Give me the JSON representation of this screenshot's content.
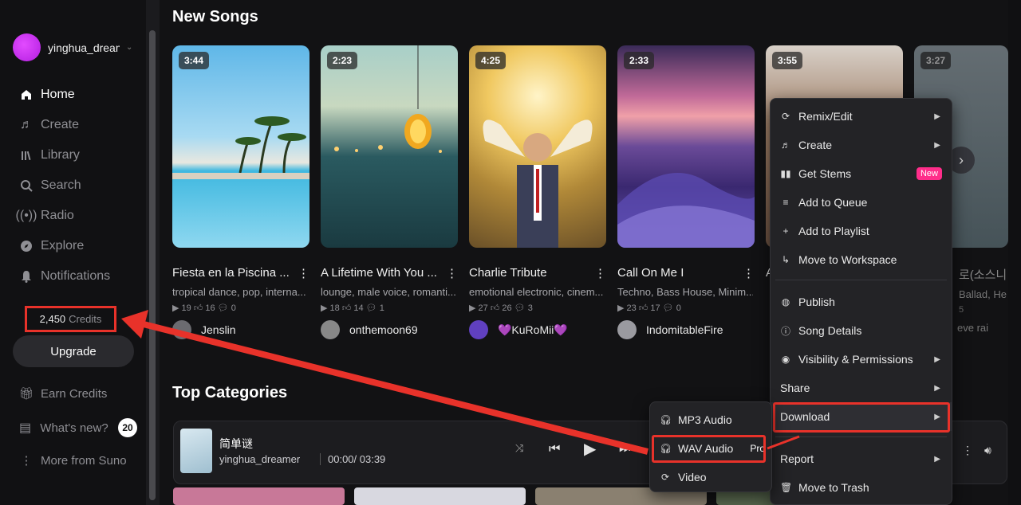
{
  "sidebar": {
    "username": "yinghua_dreamer",
    "nav": [
      {
        "label": "Home",
        "icon": "home-icon"
      },
      {
        "label": "Create",
        "icon": "music-note-icon"
      },
      {
        "label": "Library",
        "icon": "library-icon"
      },
      {
        "label": "Search",
        "icon": "search-icon"
      },
      {
        "label": "Radio",
        "icon": "radio-icon"
      },
      {
        "label": "Explore",
        "icon": "compass-icon"
      },
      {
        "label": "Notifications",
        "icon": "bell-icon"
      }
    ],
    "credits_value": "2,450",
    "credits_label": "Credits",
    "upgrade_label": "Upgrade",
    "earn_credits": "Earn Credits",
    "whats_new": "What's new?",
    "whats_new_count": "20",
    "more_from": "More from Suno"
  },
  "main": {
    "new_songs_title": "New Songs",
    "top_categories_title": "Top Categories",
    "songs": [
      {
        "duration": "3:44",
        "title": "Fiesta en la Piscina ...",
        "genre": "tropical dance, pop, interna...",
        "plays": "19",
        "likes": "16",
        "comments": "0",
        "author": "Jenslin"
      },
      {
        "duration": "2:23",
        "title": "A Lifetime With You ...",
        "genre": "lounge, male voice, romanti...",
        "plays": "18",
        "likes": "14",
        "comments": "1",
        "author": "onthemoon69"
      },
      {
        "duration": "4:25",
        "title": "Charlie Tribute",
        "genre": "emotional electronic, cinem...",
        "plays": "27",
        "likes": "26",
        "comments": "3",
        "author": "💜KuRoMii💜"
      },
      {
        "duration": "2:33",
        "title": "Call On Me I",
        "genre": "Techno, Bass House, Minim...",
        "plays": "23",
        "likes": "17",
        "comments": "0",
        "author": "IndomitableFire"
      },
      {
        "duration": "3:55",
        "title": "A",
        "genre": "",
        "plays": "",
        "likes": "",
        "comments": "",
        "author": ""
      },
      {
        "duration": "3:27",
        "title": "로(소스니",
        "genre": "Ballad, He",
        "plays": "5",
        "likes": "",
        "comments": "",
        "author": "eve rai"
      }
    ]
  },
  "player": {
    "title": "简单谜",
    "user": "yinghua_dreamer",
    "time": "00:00/  03:39"
  },
  "context_menu": {
    "items": [
      "Remix/Edit",
      "Create",
      "Get Stems",
      "Add to Queue",
      "Add to Playlist",
      "Move to Workspace",
      "Publish",
      "Song Details",
      "Visibility & Permissions",
      "Share",
      "Download",
      "Report",
      "Move to Trash"
    ],
    "new_badge": "New"
  },
  "download_submenu": {
    "items": [
      "MP3 Audio",
      "WAV Audio",
      "Video"
    ],
    "pro_label": "Pro"
  },
  "colors": {
    "accent_red": "#e8322a",
    "new_badge": "#ff2d8a"
  }
}
